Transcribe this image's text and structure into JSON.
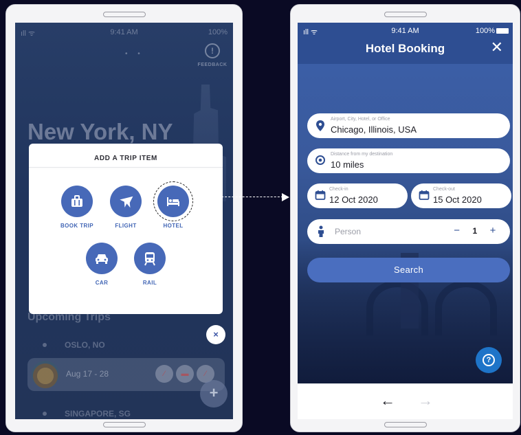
{
  "left_screen": {
    "status": {
      "signal": "ıll ᯤ",
      "time": "9:41 AM",
      "battery": "100%"
    },
    "feedback_label": "FEEDBACK",
    "city_title": "New York, NY",
    "modal": {
      "title": "ADD A TRIP ITEM",
      "options": [
        {
          "label": "BOOK TRIP",
          "icon": "briefcase-icon"
        },
        {
          "label": "FLIGHT",
          "icon": "airplane-icon"
        },
        {
          "label": "HOTEL",
          "icon": "bed-icon"
        },
        {
          "label": "CAR",
          "icon": "car-icon"
        },
        {
          "label": "RAIL",
          "icon": "train-icon"
        }
      ]
    },
    "close_label": "×",
    "upcoming_title": "Upcoming Trips",
    "trips": [
      {
        "place": "OSLO, NO"
      },
      {
        "dates": "Aug 17 - 28"
      },
      {
        "place": "SINGAPORE, SG"
      }
    ],
    "fab_label": "+"
  },
  "right_screen": {
    "status": {
      "signal": "ıll ᯤ",
      "time": "9:41 AM",
      "battery": "100%"
    },
    "title": "Hotel Booking",
    "close_label": "✕",
    "location": {
      "placeholder": "Airport, City, Hotel, or Office",
      "value": "Chicago, Illinois, USA"
    },
    "distance": {
      "placeholder": "Distance from my destination",
      "value": "10 miles"
    },
    "check_in": {
      "label": "Check-in",
      "value": "12 Oct 2020"
    },
    "check_out": {
      "label": "Check-out",
      "value": "15 Oct 2020"
    },
    "person": {
      "label": "Person",
      "minus": "−",
      "count": "1",
      "plus": "+"
    },
    "search_label": "Search",
    "help_label": "?",
    "nav": {
      "back": "←",
      "forward": "→"
    }
  },
  "colors": {
    "brand_blue": "#2e4e92",
    "option_blue": "#4769b8",
    "button_blue": "#4a6ebf",
    "help_blue": "#1e74c8"
  }
}
